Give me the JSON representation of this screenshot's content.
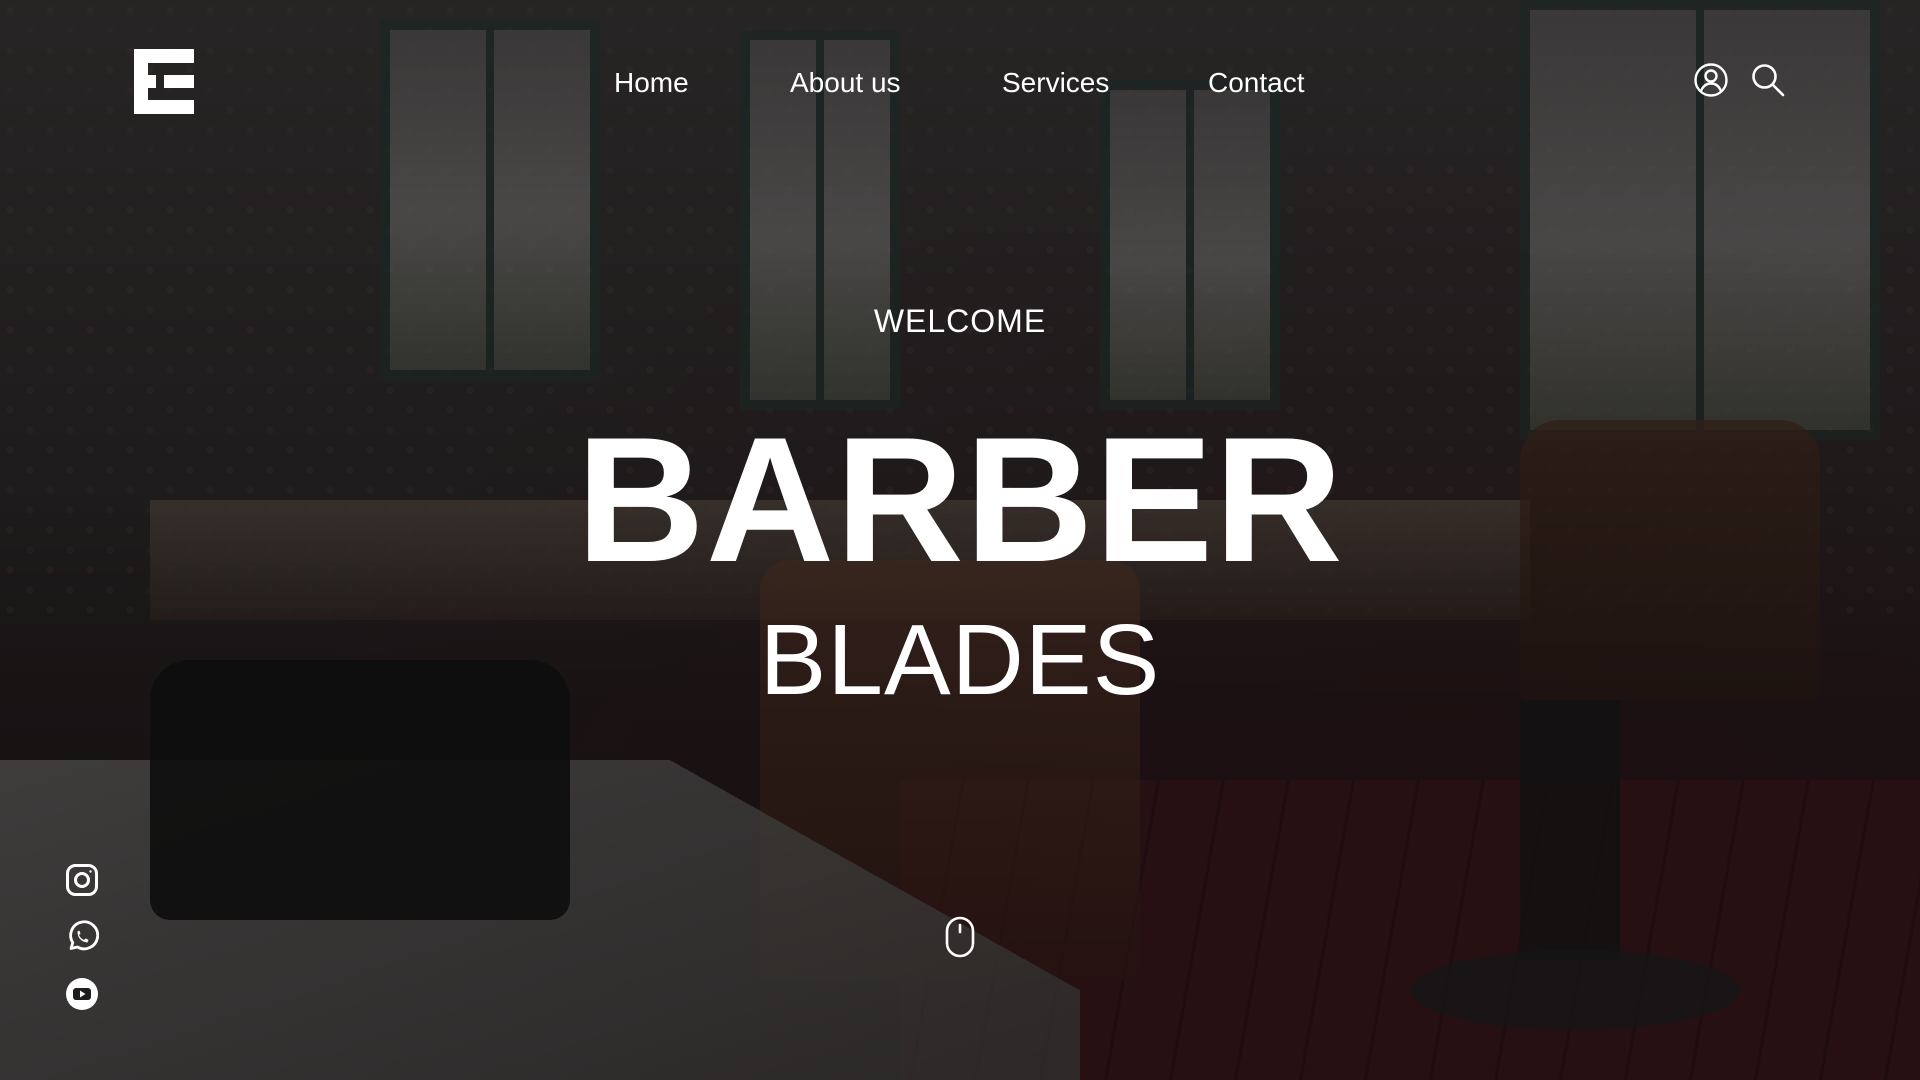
{
  "header": {
    "logo_icon": "E-logo-icon",
    "nav": [
      {
        "label": "Home"
      },
      {
        "label": "About us"
      },
      {
        "label": "Services"
      },
      {
        "label": "Contact"
      }
    ],
    "actions": [
      {
        "icon": "user-account-icon"
      },
      {
        "icon": "search-icon"
      }
    ]
  },
  "hero": {
    "welcome": "WELCOME",
    "title": "BARBER",
    "subtitle": "BLADES",
    "background": "barber-shop-interior-photo"
  },
  "social": [
    {
      "icon": "instagram-icon"
    },
    {
      "icon": "whatsapp-icon"
    },
    {
      "icon": "youtube-icon"
    }
  ],
  "scroll_indicator": {
    "icon": "mouse-scroll-icon"
  },
  "colors": {
    "text": "#ffffff",
    "overlay": "#000000"
  }
}
